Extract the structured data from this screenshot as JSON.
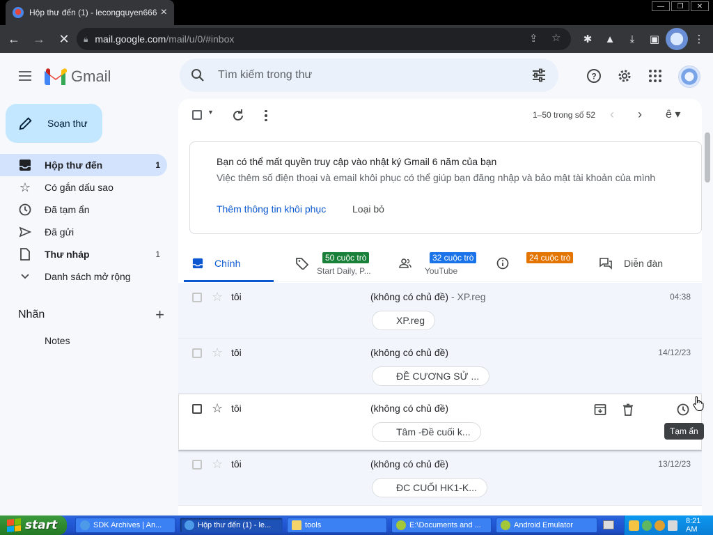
{
  "browser": {
    "tab_title": "Hộp thư đến (1) - lecongquyen666@",
    "url_host": "mail.google.com",
    "url_path": "/mail/u/0/#inbox"
  },
  "header": {
    "app_name": "Gmail",
    "search_placeholder": "Tìm kiếm trong thư"
  },
  "sidebar": {
    "compose_label": "Soạn thư",
    "items": [
      {
        "label": "Hộp thư đến",
        "count": "1",
        "icon": "inbox-icon"
      },
      {
        "label": "Có gắn dấu sao",
        "count": "",
        "icon": "star-icon"
      },
      {
        "label": "Đã tạm ẩn",
        "count": "",
        "icon": "clock-icon"
      },
      {
        "label": "Đã gửi",
        "count": "",
        "icon": "send-icon"
      },
      {
        "label": "Thư nháp",
        "count": "1",
        "icon": "draft-icon"
      },
      {
        "label": "Danh sách mở rộng",
        "count": "",
        "icon": "chevron-down-icon"
      }
    ],
    "labels_heading": "Nhãn",
    "labels": [
      "Notes"
    ]
  },
  "toolbar": {
    "pagination": "1–50 trong số 52"
  },
  "banner": {
    "title": "Bạn có thể mất quyền truy cập vào nhật ký Gmail 6 năm của bạn",
    "description": "Việc thêm số điện thoại và email khôi phục có thể giúp bạn đăng nhập và bảo mật tài khoản của mình",
    "action": "Thêm thông tin khôi phục",
    "dismiss": "Loại bỏ"
  },
  "tabs": {
    "primary": "Chính",
    "promotions_badge": "50 cuộc trò",
    "promotions_sub": "Start Daily, P...",
    "social_badge": "32 cuộc trò",
    "social_sub": "YouTube",
    "updates_badge": "24 cuộc trò",
    "forums": "Diễn đàn"
  },
  "colors": {
    "promotions_badge": "#188038",
    "social_badge": "#1a73e8",
    "updates_badge": "#e37400",
    "accent": "#0b57d0"
  },
  "emails": [
    {
      "sender": "tôi",
      "subject": "(không có chủ đề)",
      "snippet": " - XP.reg",
      "attachment": "XP.reg",
      "date": "04:38"
    },
    {
      "sender": "tôi",
      "subject": "(không có chủ đề)",
      "snippet": "",
      "attachment": "ĐỀ CƯƠNG SỬ ...",
      "date": "14/12/23"
    },
    {
      "sender": "tôi",
      "subject": "(không có chủ đề)",
      "snippet": "",
      "attachment": "Tâm -Đề cuối k...",
      "date": ""
    },
    {
      "sender": "tôi",
      "subject": "(không có chủ đề)",
      "snippet": "",
      "attachment": "ĐC CUỐI HK1-K...",
      "date": "13/12/23"
    }
  ],
  "tooltip": "Tạm ẩn",
  "taskbar": {
    "start": "start",
    "tasks": [
      "SDK Archives | An...",
      "Hộp thư đến (1) - le...",
      "tools",
      "E:\\Documents and ...",
      "Android Emulator"
    ],
    "clock": "8:21 AM"
  }
}
